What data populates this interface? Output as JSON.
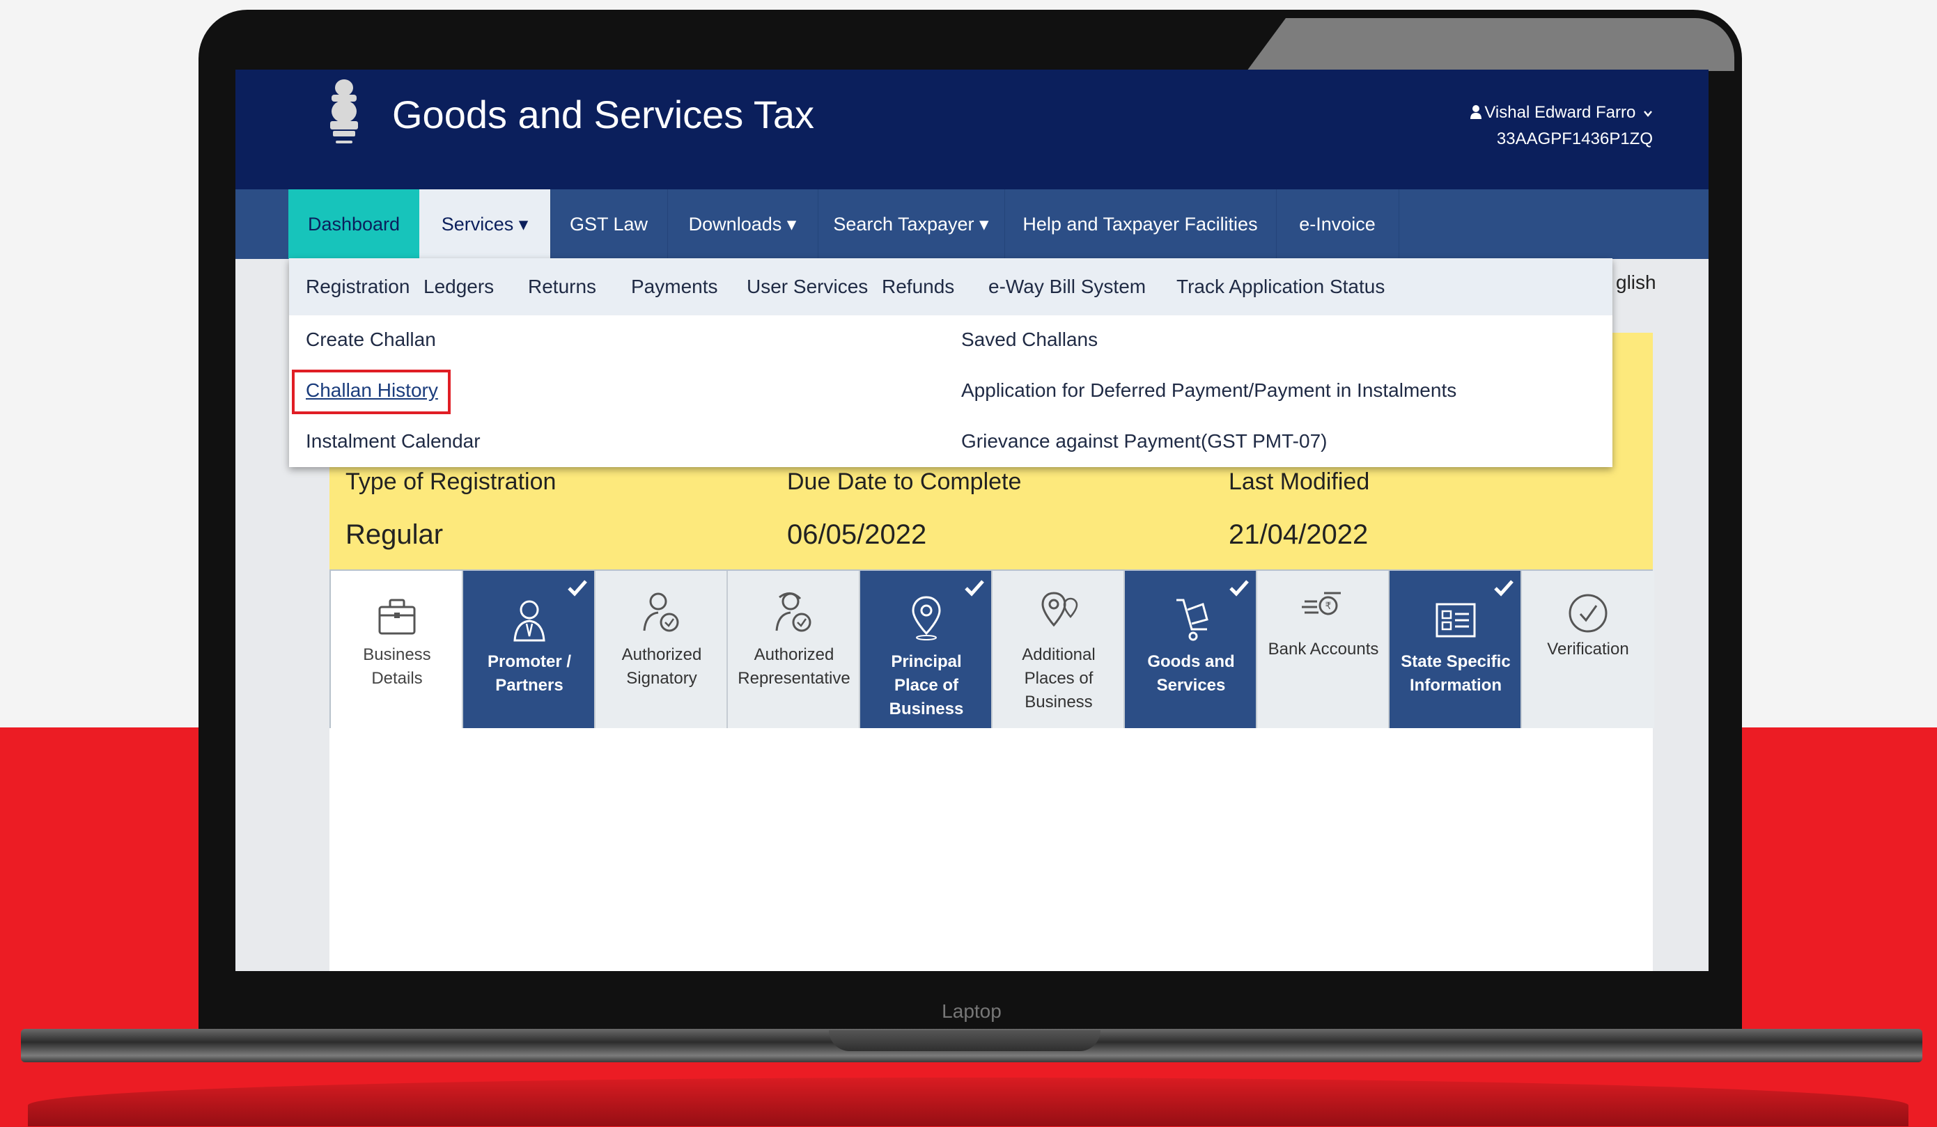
{
  "header": {
    "title": "Goods and Services Tax",
    "user_name": "Vishal Edward Farro",
    "gstin": "33AAGPF1436P1ZQ"
  },
  "nav": {
    "items": [
      {
        "label": "Dashboard"
      },
      {
        "label": "Services ▾"
      },
      {
        "label": "GST Law"
      },
      {
        "label": "Downloads ▾"
      },
      {
        "label": "Search Taxpayer ▾"
      },
      {
        "label": "Help and Taxpayer Facilities"
      },
      {
        "label": "e-Invoice"
      }
    ]
  },
  "subnav": {
    "items": [
      "Registration",
      "Ledgers",
      "Returns",
      "Payments",
      "User Services",
      "Refunds",
      "e-Way Bill System",
      "Track Application Status"
    ]
  },
  "dropdown": {
    "left_links": [
      "Create Challan",
      "Challan History",
      "Instalment Calendar"
    ],
    "right_links": [
      "Saved Challans",
      "Application for Deferred Payment/Payment in Instalments",
      "Grievance against Payment(GST PMT-07)"
    ]
  },
  "language_partial": "glish",
  "registration": {
    "type_label": "Type of Registration",
    "type_value": "Regular",
    "due_label": "Due Date to Complete",
    "due_value": "06/05/2022",
    "modified_label": "Last Modified",
    "modified_value": "21/04/2022"
  },
  "steps": [
    {
      "label": "Business\nDetails",
      "icon": "briefcase-icon",
      "status": "white"
    },
    {
      "label": "Promoter /\nPartners",
      "icon": "person-icon",
      "status": "completed"
    },
    {
      "label": "Authorized\nSignatory",
      "icon": "signatory-icon",
      "status": "grey"
    },
    {
      "label": "Authorized\nRepresentative",
      "icon": "representative-icon",
      "status": "grey"
    },
    {
      "label": "Principal\nPlace of\nBusiness",
      "icon": "location-pin-icon",
      "status": "completed"
    },
    {
      "label": "Additional\nPlaces of\nBusiness",
      "icon": "multi-location-icon",
      "status": "grey"
    },
    {
      "label": "Goods and\nServices",
      "icon": "cart-icon",
      "status": "completed"
    },
    {
      "label": "Bank Accounts",
      "icon": "bank-icon",
      "status": "grey"
    },
    {
      "label": "State Specific\nInformation",
      "icon": "info-form-icon",
      "status": "completed"
    },
    {
      "label": "Verification",
      "icon": "check-circle-icon",
      "status": "grey"
    }
  ],
  "device_label": "Laptop",
  "colors": {
    "header_bg": "#0b1f5c",
    "nav_bg": "#2c4e86",
    "active_tab": "#17c4bb",
    "highlight_border": "#e01e25",
    "info_panel": "#fde97c",
    "background_red": "#ec1c24"
  }
}
